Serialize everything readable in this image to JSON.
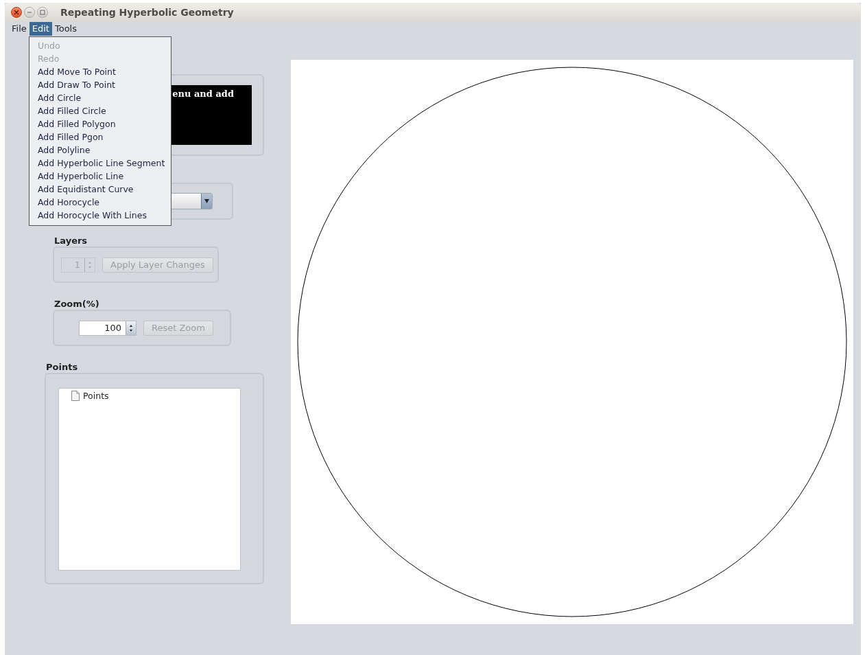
{
  "window": {
    "title": "Repeating Hyperbolic Geometry"
  },
  "menubar": [
    {
      "label": "File",
      "selected": false
    },
    {
      "label": "Edit",
      "selected": true
    },
    {
      "label": "Tools",
      "selected": false
    }
  ],
  "edit_menu": [
    {
      "label": "Undo",
      "disabled": true
    },
    {
      "label": "Redo",
      "disabled": true
    },
    {
      "label": "Add Move To Point",
      "disabled": false
    },
    {
      "label": "Add Draw To Point",
      "disabled": false
    },
    {
      "label": "Add Circle",
      "disabled": false
    },
    {
      "label": "Add Filled Circle",
      "disabled": false
    },
    {
      "label": "Add Filled Polygon",
      "disabled": false
    },
    {
      "label": "Add Filled Pgon",
      "disabled": false
    },
    {
      "label": "Add Polyline",
      "disabled": false
    },
    {
      "label": "Add Hyperbolic Line Segment",
      "disabled": false
    },
    {
      "label": "Add Hyperbolic Line",
      "disabled": false
    },
    {
      "label": "Add Equidistant Curve",
      "disabled": false
    },
    {
      "label": "Add Horocycle",
      "disabled": false
    },
    {
      "label": "Add Horocycle With Lines",
      "disabled": false
    }
  ],
  "message_box": {
    "text": "enu and add"
  },
  "layers": {
    "label": "Layers",
    "value": "1",
    "disabled": true,
    "button": {
      "label": "Apply Layer Changes",
      "disabled": true
    }
  },
  "zoom": {
    "label": "Zoom(%)",
    "value": "100",
    "disabled": false,
    "button": {
      "label": "Reset Zoom",
      "disabled": true
    }
  },
  "points": {
    "label": "Points",
    "tree": [
      {
        "label": "Points"
      }
    ]
  }
}
